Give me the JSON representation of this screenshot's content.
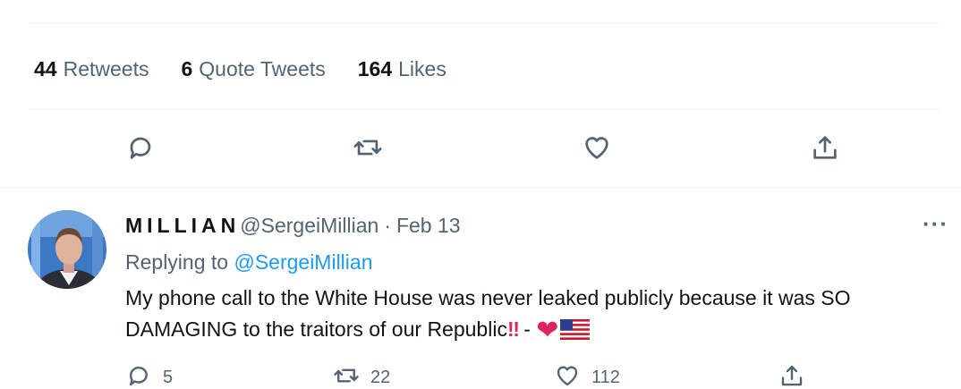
{
  "stats": {
    "retweets": {
      "count": "44",
      "label": "Retweets"
    },
    "quotes": {
      "count": "6",
      "label": "Quote Tweets"
    },
    "likes": {
      "count": "164",
      "label": "Likes"
    }
  },
  "actions": [
    "reply-icon",
    "retweet-icon",
    "like-icon",
    "share-icon"
  ],
  "reply": {
    "name": "MILLIAN",
    "handle": "@SergeiMillian",
    "separator": "·",
    "date": "Feb 13",
    "more": "···",
    "replying_prefix": "Replying to",
    "replying_to": "@SergeiMillian",
    "text": "My phone call to the White House was never leaked publicly because it was SO DAMAGING to the traitors of our Republic",
    "emphasis": "‼",
    "dash": " - ",
    "heart": "❤",
    "flag": "flag-us-icon"
  },
  "bottom_actions": {
    "reply_count": "5",
    "retweet_count": "22",
    "like_count": "112"
  },
  "colors": {
    "text": "#0f1419",
    "muted": "#536471",
    "link": "#1d9bf0",
    "divider": "#eff3f4",
    "heart": "#e0245e"
  }
}
